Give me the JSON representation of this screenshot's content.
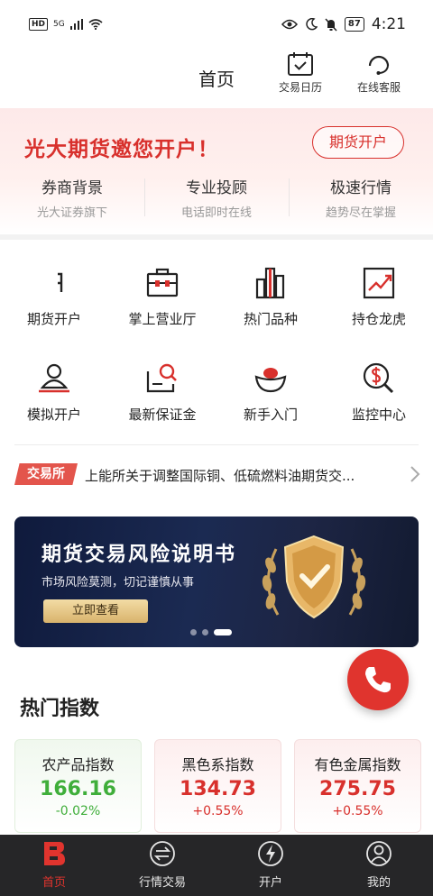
{
  "status_bar": {
    "left": "HD",
    "net": "5G",
    "battery": "87",
    "time": "4:21"
  },
  "header": {
    "title": "首页",
    "calendar_label": "交易日历",
    "service_label": "在线客服"
  },
  "promo": {
    "headline": "光大期货邀您开户！",
    "cta": "期货开户",
    "features": [
      {
        "title": "券商背景",
        "sub": "光大证券旗下"
      },
      {
        "title": "专业投顾",
        "sub": "电话即时在线"
      },
      {
        "title": "极速行情",
        "sub": "趋势尽在掌握"
      }
    ]
  },
  "quick_grid": {
    "items": [
      {
        "label": "期货开户",
        "icon": "account-open-icon"
      },
      {
        "label": "掌上营业厅",
        "icon": "briefcase-icon"
      },
      {
        "label": "热门品种",
        "icon": "bar-chart-icon"
      },
      {
        "label": "持仓龙虎",
        "icon": "trend-chart-icon"
      },
      {
        "label": "模拟开户",
        "icon": "user-icon"
      },
      {
        "label": "最新保证金",
        "icon": "doc-search-icon"
      },
      {
        "label": "新手入门",
        "icon": "ingot-icon"
      },
      {
        "label": "监控中心",
        "icon": "dollar-search-icon"
      }
    ]
  },
  "news": {
    "tag": "交易所",
    "text": "上能所关于调整国际铜、低硫燃料油期货交..."
  },
  "banner": {
    "title": "期货交易风险说明书",
    "subtitle": "市场风险莫测，切记谨慎从事",
    "button": "立即查看",
    "slide_count": 3,
    "active_slide": 3
  },
  "hot_indexes": {
    "title": "热门指数",
    "cards": [
      {
        "name": "农产品指数",
        "value": "166.16",
        "change": "-0.02%",
        "color": "#3fae3a"
      },
      {
        "name": "黑色系指数",
        "value": "134.73",
        "change": "+0.55%",
        "color": "#d8302c"
      },
      {
        "name": "有色金属指数",
        "value": "275.75",
        "change": "+0.55%",
        "color": "#d8302c"
      }
    ]
  },
  "bottom_nav": {
    "items": [
      {
        "label": "首页",
        "icon": "home-b-icon",
        "active": true
      },
      {
        "label": "行情交易",
        "icon": "exchange-icon",
        "active": false
      },
      {
        "label": "开户",
        "icon": "lightning-icon",
        "active": false
      },
      {
        "label": "我的",
        "icon": "profile-icon",
        "active": false
      }
    ]
  },
  "colors": {
    "accent": "#d8302c",
    "down": "#3fae3a",
    "nav_bg": "#262628"
  }
}
